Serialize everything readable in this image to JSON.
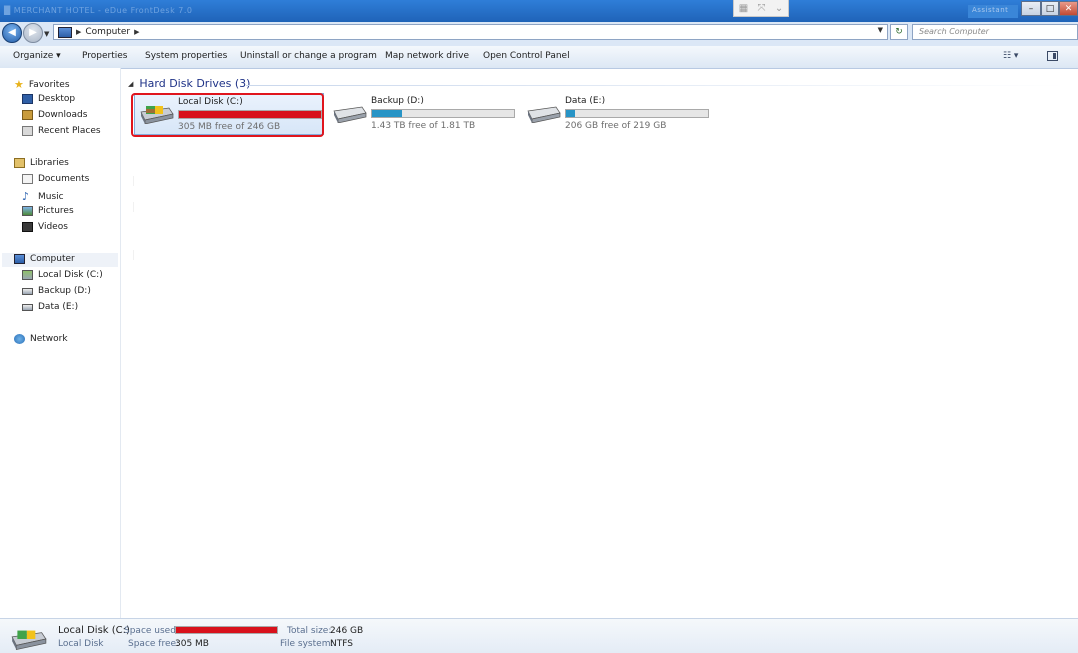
{
  "window": {
    "ghost_title": "█ MERCHANT HOTEL - eDue FrontDesk 7.0",
    "ghost_user": "Assistant",
    "controls": {
      "minimize": "–",
      "maximize": "□",
      "close": "✕"
    }
  },
  "address": {
    "crumbs": [
      "Computer"
    ],
    "search_placeholder": "Search Computer"
  },
  "toolbar": {
    "organize": "Organize ▾",
    "properties": "Properties",
    "system_properties": "System properties",
    "uninstall": "Uninstall or change a program",
    "map_drive": "Map network drive",
    "control_panel": "Open Control Panel"
  },
  "nav": {
    "favorites": "Favorites",
    "desktop": "Desktop",
    "downloads": "Downloads",
    "recent_places": "Recent Places",
    "libraries": "Libraries",
    "documents": "Documents",
    "music": "Music",
    "pictures": "Pictures",
    "videos": "Videos",
    "computer": "Computer",
    "local_disk": "Local Disk (C:)",
    "backup": "Backup (D:)",
    "data": "Data (E:)",
    "network": "Network"
  },
  "content": {
    "group_header": "Hard Disk Drives (3)",
    "drives": [
      {
        "name": "Local Disk (C:)",
        "free_text": "305 MB free of 246 GB",
        "used_fraction": 0.9988,
        "bar_color": "#d8111b"
      },
      {
        "name": "Backup (D:)",
        "free_text": "1.43 TB free of 1.81 TB",
        "used_fraction": 0.21,
        "bar_color": "#2794c6"
      },
      {
        "name": "Data (E:)",
        "free_text": "206 GB free of 219 GB",
        "used_fraction": 0.06,
        "bar_color": "#2794c6"
      }
    ]
  },
  "details": {
    "name": "Local Disk (C:)",
    "type": "Local Disk",
    "space_used_label": "Space used:",
    "space_free_label": "Space free:",
    "space_free_value": "305 MB",
    "total_size_label": "Total size:",
    "total_size_value": "246 GB",
    "fs_label": "File system:",
    "fs_value": "NTFS",
    "used_fraction": 0.9988,
    "bar_color": "#d8111b"
  }
}
